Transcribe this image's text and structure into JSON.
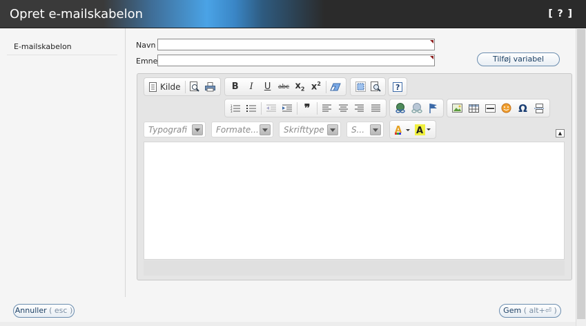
{
  "window": {
    "title": "Opret e-mailskabelon",
    "help_label": "[ ? ]"
  },
  "sidebar": {
    "items": [
      {
        "label": "E-mailskabelon"
      }
    ]
  },
  "form": {
    "name": {
      "label": "Navn",
      "value": ""
    },
    "subject": {
      "label": "Emne",
      "value": ""
    },
    "add_variable_label": "Tilføj variabel"
  },
  "editor": {
    "toolbar": {
      "source_label": "Kilde",
      "row1_groups": [
        [
          "source-icon",
          "preview-icon",
          "print-icon"
        ],
        [
          "bold-icon",
          "italic-icon",
          "underline-icon",
          "strikethrough-icon",
          "subscript-icon",
          "superscript-icon"
        ],
        [
          "eraser-icon"
        ],
        [
          "select-all-icon",
          "find-icon"
        ],
        [
          "help-icon"
        ]
      ],
      "row2_groups": [
        [
          "numbered-list-icon",
          "bullet-list-icon",
          "outdent-icon",
          "indent-icon",
          "blockquote-icon",
          "align-left-icon",
          "align-center-icon",
          "align-right-icon",
          "justify-icon"
        ],
        [
          "link-icon",
          "unlink-icon",
          "anchor-icon"
        ],
        [
          "image-icon",
          "table-icon",
          "horizontal-rule-icon",
          "smiley-icon",
          "special-char-icon",
          "page-break-icon"
        ]
      ],
      "combos": {
        "styles": "Typografi",
        "format": "Formate...",
        "font": "Skrifttype",
        "size": "S..."
      },
      "row3_icons": [
        "text-color-icon",
        "background-color-icon"
      ]
    },
    "content": ""
  },
  "footer": {
    "cancel_label": "Annuller",
    "cancel_hint": "( esc )",
    "save_label": "Gem",
    "save_hint": "( alt+⏎ )"
  },
  "colors": {
    "titlebar_dark": "#2b2b2b",
    "titlebar_accent": "#4aa3e6",
    "button_border": "#6a8cae",
    "button_text": "#1b3f63",
    "required_marker": "#8b1a1a"
  }
}
